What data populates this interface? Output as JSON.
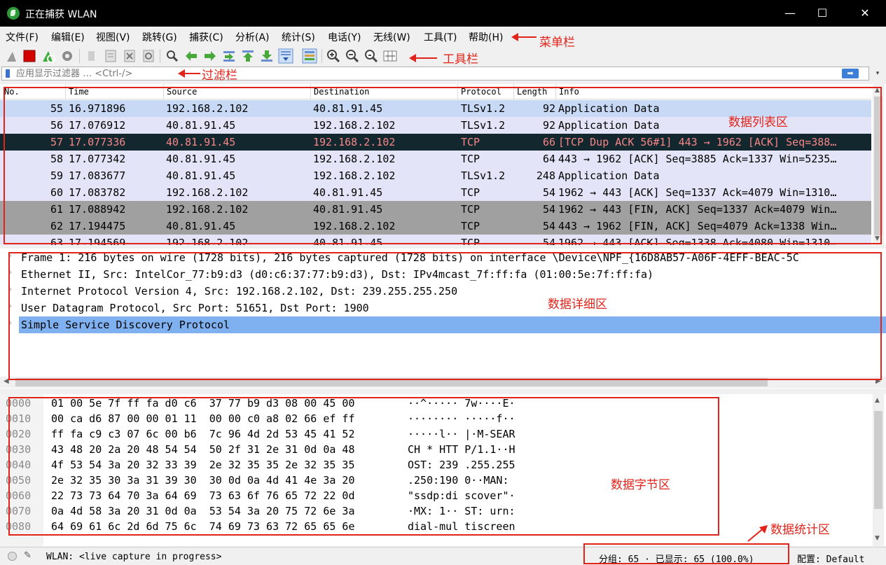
{
  "window": {
    "title": "正在捕获 WLAN",
    "controls": {
      "minimize": "—",
      "maximize": "☐",
      "close": "✕"
    }
  },
  "menu": [
    "文件(F)",
    "编辑(E)",
    "视图(V)",
    "跳转(G)",
    "捕获(C)",
    "分析(A)",
    "统计(S)",
    "电话(Y)",
    "无线(W)",
    "工具(T)",
    "帮助(H)"
  ],
  "toolbar": {
    "icons": [
      "shark-fin-start-icon",
      "stop-icon",
      "restart-icon",
      "options-gear-icon",
      "open-file-icon",
      "save-file-icon",
      "close-file-icon",
      "reload-icon",
      "find-icon",
      "go-back-icon",
      "go-forward-icon",
      "go-to-packet-icon",
      "go-first-icon",
      "go-last-icon",
      "autoscroll-icon",
      "colorize-icon",
      "zoom-in-icon",
      "zoom-out-icon",
      "zoom-normal-icon",
      "resize-columns-icon"
    ]
  },
  "filter": {
    "placeholder": "应用显示过滤器 … <Ctrl-/>",
    "apply_symbol": "➡",
    "dropdown_symbol": "▾"
  },
  "packet_list": {
    "columns": [
      "No.",
      "Time",
      "Source",
      "Destination",
      "Protocol",
      "Length",
      "Info"
    ],
    "rows": [
      {
        "no": "55",
        "time": "16.971896",
        "source": "192.168.2.102",
        "destination": "40.81.91.45",
        "protocol": "TLSv1.2",
        "length": "92",
        "info": "Application Data",
        "bg": "#c7d9f5",
        "fg": "#000000"
      },
      {
        "no": "56",
        "time": "17.076912",
        "source": "40.81.91.45",
        "destination": "192.168.2.102",
        "protocol": "TLSv1.2",
        "length": "92",
        "info": "Application Data",
        "bg": "#e4e4f8",
        "fg": "#000000"
      },
      {
        "no": "57",
        "time": "17.077336",
        "source": "40.81.91.45",
        "destination": "192.168.2.102",
        "protocol": "TCP",
        "length": "66",
        "info": "[TCP Dup ACK 56#1] 443 → 1962 [ACK] Seq=388…",
        "bg": "#12272e",
        "fg": "#f78787"
      },
      {
        "no": "58",
        "time": "17.077342",
        "source": "40.81.91.45",
        "destination": "192.168.2.102",
        "protocol": "TCP",
        "length": "64",
        "info": "443 → 1962 [ACK] Seq=3885 Ack=1337 Win=5235…",
        "bg": "#e4e4f8",
        "fg": "#000000"
      },
      {
        "no": "59",
        "time": "17.083677",
        "source": "40.81.91.45",
        "destination": "192.168.2.102",
        "protocol": "TLSv1.2",
        "length": "248",
        "info": "Application Data",
        "bg": "#e4e4f8",
        "fg": "#000000"
      },
      {
        "no": "60",
        "time": "17.083782",
        "source": "192.168.2.102",
        "destination": "40.81.91.45",
        "protocol": "TCP",
        "length": "54",
        "info": "1962 → 443 [ACK] Seq=1337 Ack=4079 Win=1310…",
        "bg": "#e4e4f8",
        "fg": "#000000"
      },
      {
        "no": "61",
        "time": "17.088942",
        "source": "192.168.2.102",
        "destination": "40.81.91.45",
        "protocol": "TCP",
        "length": "54",
        "info": "1962 → 443 [FIN, ACK] Seq=1337 Ack=4079 Win…",
        "bg": "#a0a0a0",
        "fg": "#000000"
      },
      {
        "no": "62",
        "time": "17.194475",
        "source": "40.81.91.45",
        "destination": "192.168.2.102",
        "protocol": "TCP",
        "length": "54",
        "info": "443 → 1962 [FIN, ACK] Seq=4079 Ack=1338 Win…",
        "bg": "#a0a0a0",
        "fg": "#000000"
      },
      {
        "no": "63",
        "time": "17.194569",
        "source": "192.168.2.102",
        "destination": "40.81.91.45",
        "protocol": "TCP",
        "length": "54",
        "info": "1962 → 443 [ACK] Seq=1338 Ack=4080 Win=1310…",
        "bg": "#e4e4f8",
        "fg": "#000000"
      }
    ]
  },
  "details": {
    "rows": [
      {
        "text": "Frame 1: 216 bytes on wire (1728 bits), 216 bytes captured (1728 bits) on interface \\Device\\NPF_{16D8AB57-A06F-4EFF-BEAC-5C",
        "selected": false
      },
      {
        "text": "Ethernet II, Src: IntelCor_77:b9:d3 (d0:c6:37:77:b9:d3), Dst: IPv4mcast_7f:ff:fa (01:00:5e:7f:ff:fa)",
        "selected": false
      },
      {
        "text": "Internet Protocol Version 4, Src: 192.168.2.102, Dst: 239.255.255.250",
        "selected": false
      },
      {
        "text": "User Datagram Protocol, Src Port: 51651, Dst Port: 1900",
        "selected": false
      },
      {
        "text": "Simple Service Discovery Protocol",
        "selected": true
      }
    ],
    "expander": "›"
  },
  "bytes": {
    "rows": [
      {
        "offset": "0000",
        "hex": "01 00 5e 7f ff fa d0 c6  37 77 b9 d3 08 00 45 00",
        "ascii": "··^····· 7w····E·"
      },
      {
        "offset": "0010",
        "hex": "00 ca d6 87 00 00 01 11  00 00 c0 a8 02 66 ef ff",
        "ascii": "········ ·····f··"
      },
      {
        "offset": "0020",
        "hex": "ff fa c9 c3 07 6c 00 b6  7c 96 4d 2d 53 45 41 52",
        "ascii": "·····l·· |·M-SEAR"
      },
      {
        "offset": "0030",
        "hex": "43 48 20 2a 20 48 54 54  50 2f 31 2e 31 0d 0a 48",
        "ascii": "CH * HTT P/1.1··H"
      },
      {
        "offset": "0040",
        "hex": "4f 53 54 3a 20 32 33 39  2e 32 35 35 2e 32 35 35",
        "ascii": "OST: 239 .255.255"
      },
      {
        "offset": "0050",
        "hex": "2e 32 35 30 3a 31 39 30  30 0d 0a 4d 41 4e 3a 20",
        "ascii": ".250:190 0··MAN: "
      },
      {
        "offset": "0060",
        "hex": "22 73 73 64 70 3a 64 69  73 63 6f 76 65 72 22 0d",
        "ascii": "\"ssdp:di scover\"·"
      },
      {
        "offset": "0070",
        "hex": "0a 4d 58 3a 20 31 0d 0a  53 54 3a 20 75 72 6e 3a",
        "ascii": "·MX: 1·· ST: urn:"
      },
      {
        "offset": "0080",
        "hex": "64 69 61 6c 2d 6d 75 6c  74 69 73 63 72 65 65 6e",
        "ascii": "dial-mul tiscreen"
      }
    ]
  },
  "status": {
    "interface": "WLAN: <live capture in progress>",
    "counts": "分组: 65 · 已显示: 65 (100.0%)",
    "profile": "配置: Default"
  },
  "annotations": {
    "menubar": "菜单栏",
    "toolbar": "工具栏",
    "filterbar": "过滤栏",
    "packet_list": "数据列表区",
    "details": "数据详细区",
    "bytes": "数据字节区",
    "stats": "数据统计区",
    "color": "#e2231a"
  }
}
